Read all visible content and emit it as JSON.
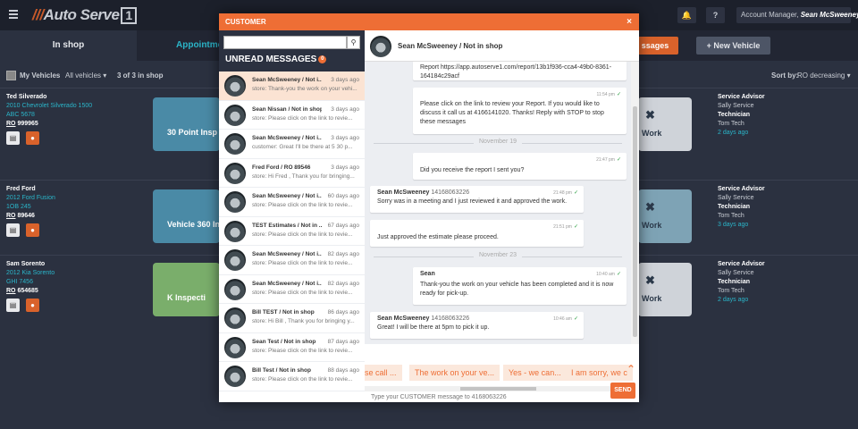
{
  "app": {
    "logo_slash": "///",
    "logo_text": "Auto Serve",
    "logo_box": "1",
    "account_label": "Account Manager,",
    "account_name": "Sean McSweeney",
    "help_label": "?",
    "tabs": [
      "In shop",
      "Appointme"
    ],
    "messages_btn": "ssages",
    "new_vehicle_btn": "New Vehicle",
    "my_vehicles": "My Vehicles",
    "all_vehicles": "All vehicles",
    "count": "3 of 3 in shop",
    "sort_label": "Sort by:",
    "sort_value": "RO decreasing",
    "vehicles": [
      {
        "name": "Ted Silverado",
        "model": "2010 Chevrolet Silverado 1500",
        "plate": "ABC 5678",
        "ro_label": "RO",
        "ro": "999965",
        "card": "30 Point Insp",
        "work": "Work",
        "advisor_label": "Service Advisor",
        "advisor": "Sally Service",
        "tech_label": "Technician",
        "tech": "Tom Tech",
        "ago": "2 days ago"
      },
      {
        "name": "Fred Ford",
        "model": "2012 Ford Fusion",
        "plate": "1OB 245",
        "ro_label": "RO",
        "ro": "89646",
        "card": "Vehicle 360 Ins",
        "work": "Work",
        "advisor_label": "Service Advisor",
        "advisor": "Sally Service",
        "tech_label": "Technician",
        "tech": "Tom Tech",
        "ago": "3 days ago"
      },
      {
        "name": "Sam Sorento",
        "model": "2012 Kia Sorento",
        "plate": "GHI 7456",
        "ro_label": "RO",
        "ro": "654685",
        "card": "K Inspecti",
        "work": "Work",
        "advisor_label": "Service Advisor",
        "advisor": "Sally Service",
        "tech_label": "Technician",
        "tech": "Tom Tech",
        "ago": "2 days ago"
      }
    ]
  },
  "modal": {
    "title": "CUSTOMER",
    "close_icon": "×",
    "search_placeholder": "",
    "unread_title": "UNREAD MESSAGES",
    "unread_count": "0",
    "conversations": [
      {
        "name": "Sean McSweeney / Not i...",
        "date": "3 days ago",
        "preview": "store: Thank-you the work on your vehi..."
      },
      {
        "name": "Sean Nissan / Not in shop",
        "date": "3 days ago",
        "preview": "store: Please click on the link to revie..."
      },
      {
        "name": "Sean McSweeney / Not i...",
        "date": "3 days ago",
        "preview": "customer: Great I'll be there at 5 30 p..."
      },
      {
        "name": "Fred Ford / RO 89546",
        "date": "3 days ago",
        "preview": "store: Hi Fred , Thank you for bringing..."
      },
      {
        "name": "Sean McSweeney / Not i...",
        "date": "60 days ago",
        "preview": "store: Please click on the link to revie..."
      },
      {
        "name": "TEST Estimates / Not in ...",
        "date": "67 days ago",
        "preview": "store: Please click on the link to revie..."
      },
      {
        "name": "Sean McSweeney / Not i...",
        "date": "82 days ago",
        "preview": "store: Please click on the link to revie..."
      },
      {
        "name": "Sean McSweeney / Not i...",
        "date": "82 days ago",
        "preview": "store: Please click on the link to revie..."
      },
      {
        "name": "Bill TEST / Not in shop",
        "date": "86 days ago",
        "preview": "store: Hi Bill , Thank you for bringing y..."
      },
      {
        "name": "Sean Test / Not in shop",
        "date": "87 days ago",
        "preview": "store: Please click on the link to revie..."
      },
      {
        "name": "Bill Test / Not in shop",
        "date": "88 days ago",
        "preview": "store: Please click on the link to revie..."
      }
    ],
    "chat_title": "Sean McSweeney",
    "chat_sep": "/",
    "chat_status": "Not in shop",
    "messages": {
      "m1": "Report https://app.autoserve1.com/report/13b1f936-cca4-49b0-8361-164184c29acf",
      "m2_time": "11:54 pm",
      "m2": "Please click on the link to review your Report. If you would like to discuss it call us at 4166141020. Thanks! Reply with STOP to stop these messages",
      "div1": "November 19",
      "m3_time": "21:47 pm",
      "m3": "Did you receive the report I sent you?",
      "m4_name": "Sean McSweeney",
      "m4_phone": "14168063226",
      "m4_time": "21:48 pm",
      "m4": "Sorry was in a meeting and I just reviewed it and approved the work.",
      "m5_time": "21:51 pm",
      "m5": "Just approved the estimate please proceed.",
      "div2": "November 23",
      "m6_name": "Sean",
      "m6_time": "10:40 am",
      "m6": "Thank-you the work on your vehicle has been completed and it is now ready for pick-up.",
      "m7_name": "Sean McSweeney",
      "m7_phone": "14168063226",
      "m7_time": "10:46 am",
      "m7": "Great! I will be there at 5pm to pick it up."
    },
    "quick_replies": [
      "se call ...",
      "The work on your ve...",
      "Yes - we can...",
      "I am sorry, we c"
    ],
    "composer_placeholder": "Type your CUSTOMER message to 4168063226",
    "send_label": "SEND"
  },
  "colors": {
    "accent": "#ee6e35",
    "link": "#2bb5c9",
    "dark_bg": "#2b3140"
  }
}
